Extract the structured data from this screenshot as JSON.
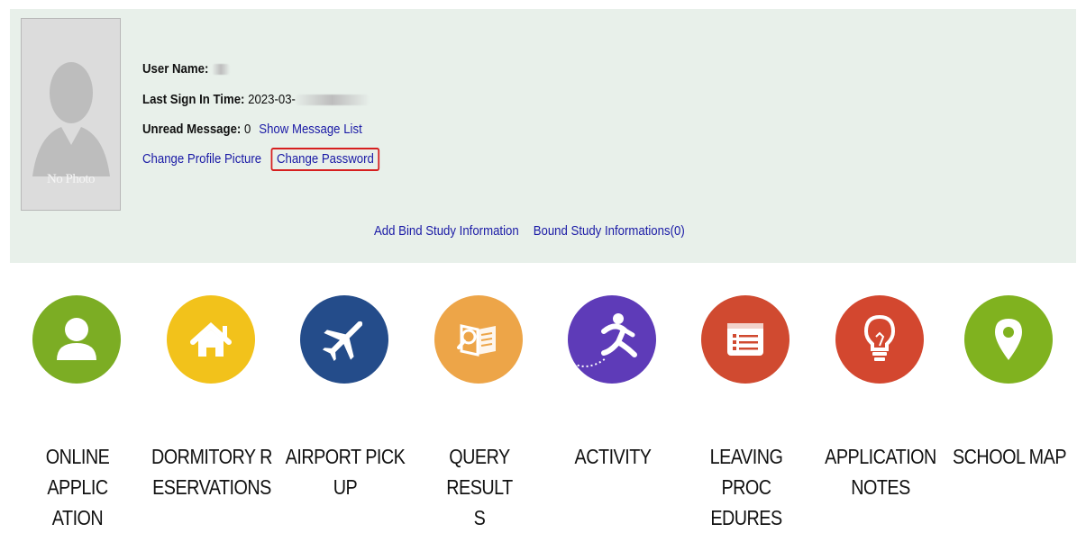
{
  "profile": {
    "photo_caption": "No Photo",
    "user_name_label": "User Name:",
    "user_name_value": "",
    "last_sign_in_label": "Last Sign In Time:",
    "last_sign_in_value": "2023-03-",
    "unread_label": "Unread Message:",
    "unread_count": "0",
    "show_message_list": "Show Message List",
    "change_profile_picture": "Change Profile Picture",
    "change_password": "Change Password",
    "add_bind_study": "Add Bind Study Information",
    "bound_study": "Bound Study Informations(0)"
  },
  "tiles": [
    {
      "label_line1": "ONLINE APPLIC",
      "label_line2": "ATION",
      "icon": "person-icon",
      "color": "#7cad24"
    },
    {
      "label_line1": "DORMITORY R",
      "label_line2": "ESERVATIONS",
      "icon": "house-icon",
      "color": "#f2c21b"
    },
    {
      "label_line1": "AIRPORT PICK",
      "label_line2": "UP",
      "icon": "airplane-icon",
      "color": "#244c8a"
    },
    {
      "label_line1": "QUERY RESULT",
      "label_line2": "S",
      "icon": "document-search-icon",
      "color": "#eda548"
    },
    {
      "label_line1": "ACTIVITY",
      "label_line2": "",
      "icon": "running-figure-icon",
      "color": "#5e3bb8"
    },
    {
      "label_line1": "LEAVING PROC",
      "label_line2": "EDURES",
      "icon": "list-form-icon",
      "color": "#d04a30"
    },
    {
      "label_line1": "APPLICATION",
      "label_line2": "NOTES",
      "icon": "lightbulb-icon",
      "color": "#d3472f"
    },
    {
      "label_line1": "SCHOOL MAP",
      "label_line2": "",
      "icon": "map-pin-icon",
      "color": "#80b21f"
    }
  ]
}
